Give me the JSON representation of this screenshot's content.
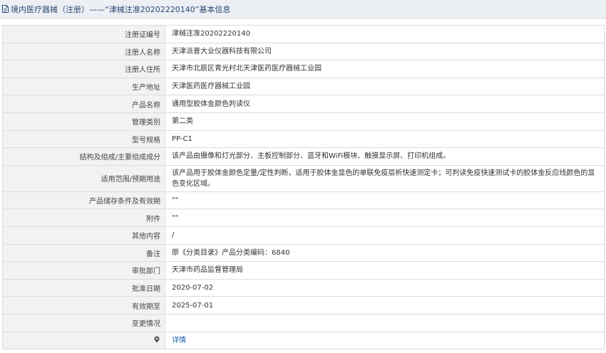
{
  "header": {
    "title": "境内医疗器械（注册）——“津械注准20202220140”基本信息"
  },
  "rows": [
    {
      "label": "注册证编号",
      "value": "津械注准20202220140"
    },
    {
      "label": "注册人名称",
      "value": "天津派普大业仪器科技有限公司"
    },
    {
      "label": "注册人住所",
      "value": "天津市北辰区青光村北天津医药医疗器械工业园"
    },
    {
      "label": "生产地址",
      "value": "天津医药医疗器械工业园"
    },
    {
      "label": "产品名称",
      "value": "通用型胶体金颜色判读仪"
    },
    {
      "label": "管理类别",
      "value": "第二类"
    },
    {
      "label": "型号规格",
      "value": "PP-C1"
    },
    {
      "label": "结构及组成/主要组成成分",
      "value": "该产品由摄像和灯光部分、主板控制部分、蓝牙和WiFi模块、触摸显示屏、打印机组成。"
    },
    {
      "label": "适用范围/预期用途",
      "value": "该产品用于胶体金颜色定量/定性判断，适用于胶体金显色的单联免疫层析快速测定卡；可判读免疫快速测试卡的胶体金反应线颜色的显色变化区域。"
    },
    {
      "label": "产品储存条件及有效期",
      "value": "\"\""
    },
    {
      "label": "附件",
      "value": "\"\""
    },
    {
      "label": "其他内容",
      "value": "/"
    },
    {
      "label": "备注",
      "value": "原《分类目录》产品分类编码：6840"
    },
    {
      "label": "审批部门",
      "value": "天津市药品监督管理局"
    },
    {
      "label": "批准日期",
      "value": "2020-07-02"
    },
    {
      "label": "有效期至",
      "value": "2025-07-01"
    },
    {
      "label": "变更情况",
      "value": ""
    }
  ],
  "footer_row": {
    "label_icon": "pin-icon",
    "link_label": "详情"
  }
}
